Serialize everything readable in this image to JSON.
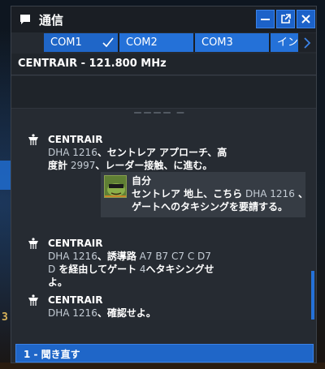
{
  "window": {
    "title": "通信",
    "icons": {
      "title": "chat-bubble-icon",
      "minimize": "minimize-icon",
      "popout": "popout-icon",
      "close": "close-icon"
    }
  },
  "tabs": [
    {
      "label": "COM1",
      "active": true
    },
    {
      "label": "COM2",
      "active": false
    },
    {
      "label": "COM3",
      "active": false
    },
    {
      "label": "イン",
      "active": false
    }
  ],
  "frequency": {
    "label": "CENTRAIR - 121.800 MHz"
  },
  "feed": {
    "cut_off_line": "ーーーー ー",
    "messages": [
      {
        "sender": "CENTRAIR",
        "line1": [
          "DHA 1216",
          "、セントレア アプローチ、高"
        ],
        "line2": [
          "度計",
          " 2997",
          "、レーダー接触、に進む。"
        ]
      },
      {
        "sender": "CENTRAIR",
        "line1": [
          "DHA 1216",
          "、誘導路",
          " A7 B7 C7 C D7"
        ],
        "line2": [
          "D",
          " を経由してゲート",
          " 4",
          "へタキシングせ"
        ],
        "line3": [
          "よ。"
        ]
      },
      {
        "sender": "CENTRAIR",
        "line1": [
          "DHA 1216",
          "、確認せよ。"
        ]
      }
    ],
    "self_message": {
      "sender": "自分",
      "line1": [
        "セントレア 地上、こちら",
        " DHA 1216",
        " 、"
      ],
      "line2": [
        "ゲートへのタキシングを要請する。"
      ]
    }
  },
  "reply": {
    "option": "1 - 聞き直す"
  },
  "background": {
    "left_number": "3"
  },
  "colors": {
    "accent": "#2471d8",
    "panel": "#252a31",
    "titlebar": "#1a1e24"
  }
}
